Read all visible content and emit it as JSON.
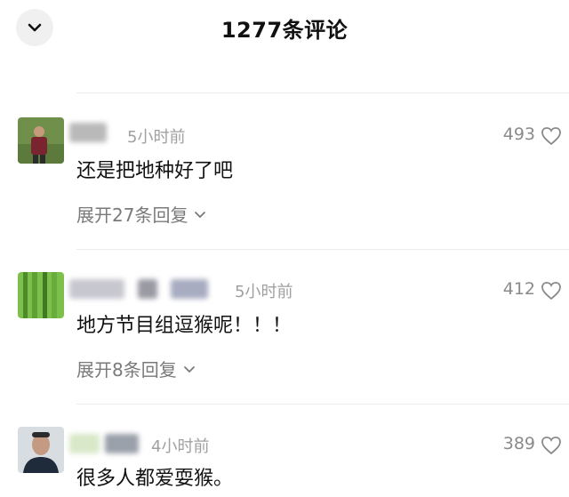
{
  "header": {
    "title": "1277条评论",
    "back_icon": "chevron-down-icon"
  },
  "comments": [
    {
      "time": "5小时前",
      "likes": "493",
      "text": "还是把地种好了吧",
      "replies": "展开27条回复"
    },
    {
      "time": "5小时前",
      "likes": "412",
      "text": "地方节目组逗猴呢！！！",
      "replies": "展开8条回复"
    },
    {
      "time": "4小时前",
      "likes": "389",
      "text": "很多人都爱耍猴。"
    }
  ],
  "icons": {
    "like": "heart-outline-icon",
    "expand": "chevron-down-icon"
  }
}
